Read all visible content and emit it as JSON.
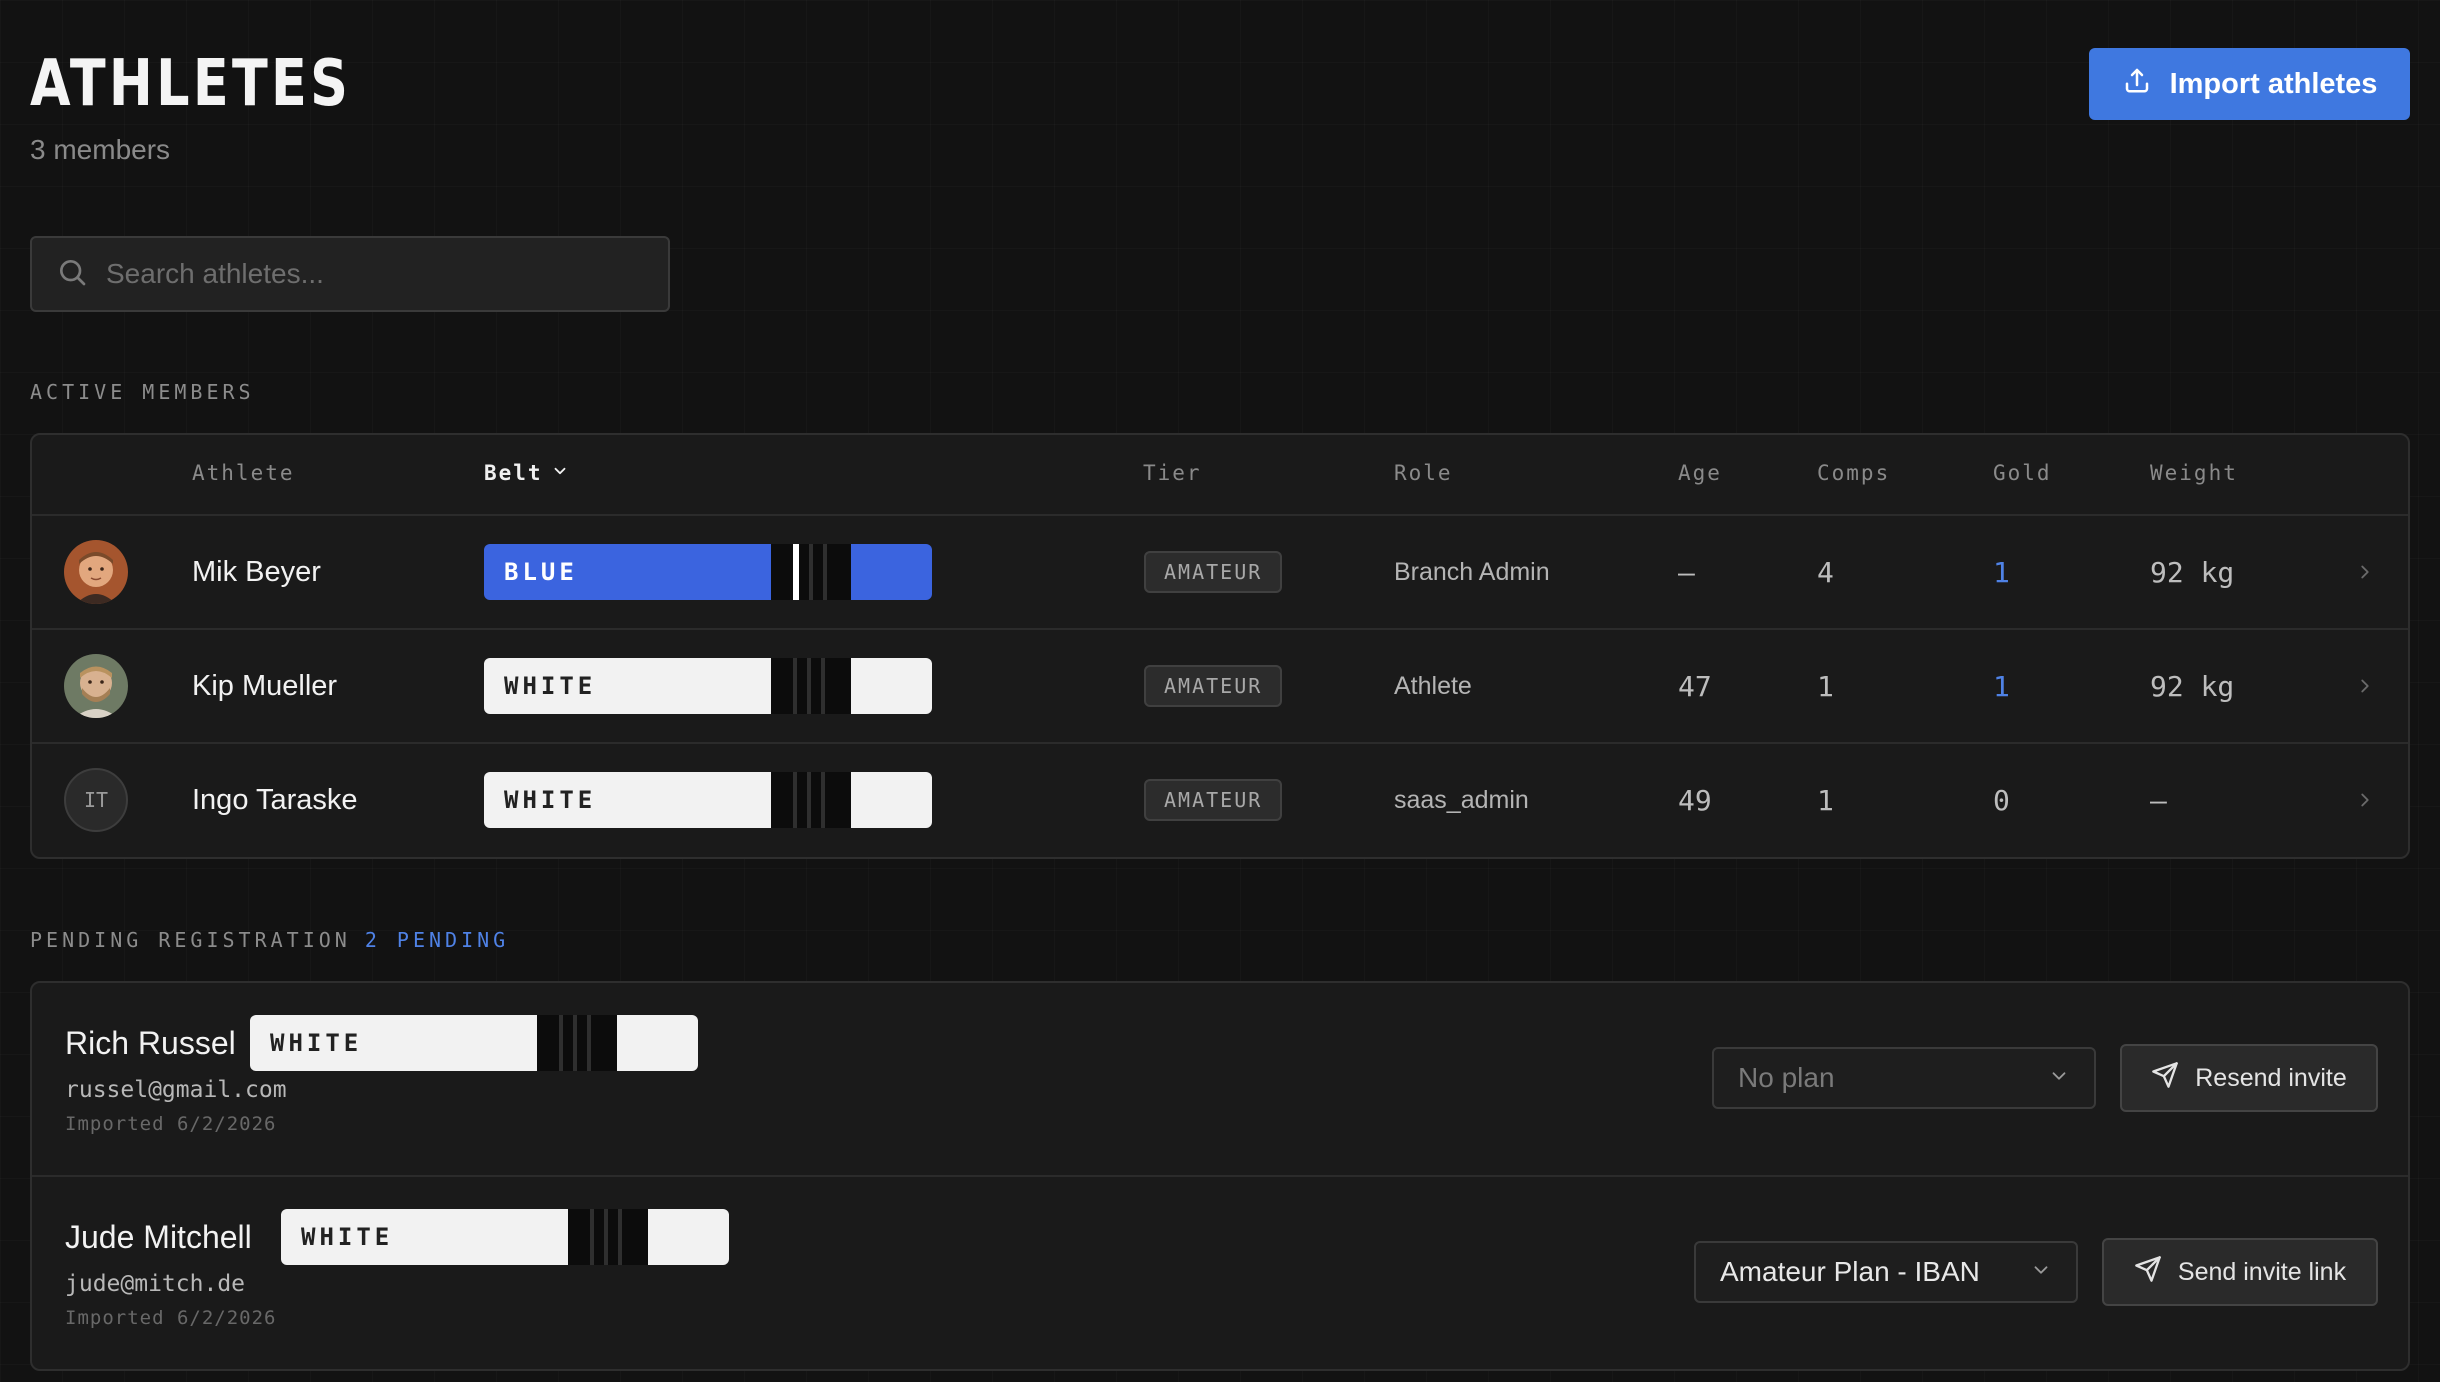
{
  "header": {
    "title": "ATHLETES",
    "member_count": "3 members",
    "import_label": "Import athletes"
  },
  "search": {
    "placeholder": "Search athletes..."
  },
  "active": {
    "section_label": "ACTIVE MEMBERS",
    "columns": {
      "athlete": "Athlete",
      "belt": "Belt",
      "tier": "Tier",
      "role": "Role",
      "age": "Age",
      "comps": "Comps",
      "gold": "Gold",
      "weight": "Weight"
    },
    "rows": [
      {
        "initials": "",
        "name": "Mik Beyer",
        "belt": "BLUE",
        "tier": "AMATEUR",
        "role": "Branch Admin",
        "age": "—",
        "comps": "4",
        "gold": "1",
        "weight": "92 kg"
      },
      {
        "initials": "",
        "name": "Kip Mueller",
        "belt": "WHITE",
        "tier": "AMATEUR",
        "role": "Athlete",
        "age": "47",
        "comps": "1",
        "gold": "1",
        "weight": "92 kg"
      },
      {
        "initials": "IT",
        "name": "Ingo Taraske",
        "belt": "WHITE",
        "tier": "AMATEUR",
        "role": "saas_admin",
        "age": "49",
        "comps": "1",
        "gold": "0",
        "weight": "—"
      }
    ]
  },
  "pending": {
    "section_label": "PENDING REGISTRATION",
    "count_label": "2 PENDING",
    "rows": [
      {
        "name": "Rich Russel",
        "belt": "WHITE",
        "email": "russel@gmail.com",
        "imported": "Imported 6/2/2026",
        "plan": "No plan",
        "action": "Resend invite"
      },
      {
        "name": "Jude Mitchell",
        "belt": "WHITE",
        "email": "jude@mitch.de",
        "imported": "Imported 6/2/2026",
        "plan": "Amateur Plan - IBAN",
        "action": "Send invite link"
      }
    ]
  },
  "colors": {
    "accent": "#3f78e0",
    "belt_blue": "#3b64df",
    "belt_white": "#f2f2f2",
    "background": "#121212"
  },
  "icons": {
    "import": "upload-icon",
    "search": "search-icon",
    "sort": "chevron-down-icon",
    "row": "chevron-right-icon",
    "send": "send-icon"
  }
}
